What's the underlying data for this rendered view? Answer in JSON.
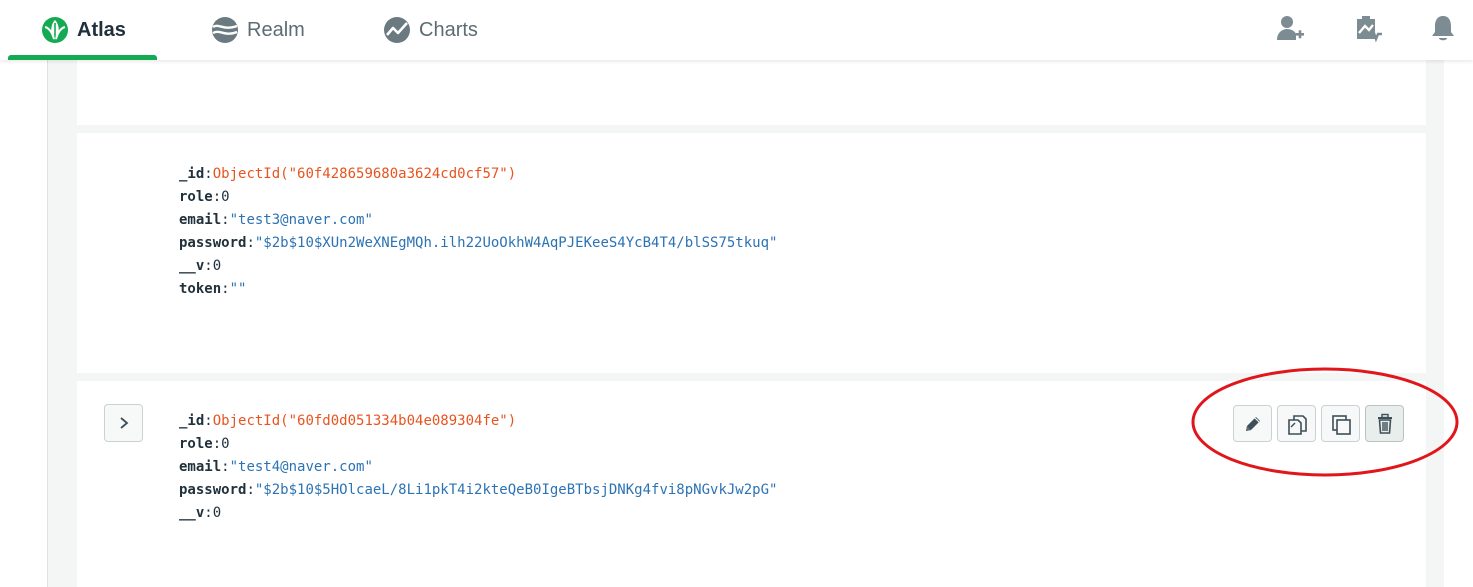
{
  "topnav": {
    "tabs": [
      {
        "label": "Atlas",
        "icon": "atlas-leaf-icon",
        "active": true
      },
      {
        "label": "Realm",
        "icon": "realm-icon",
        "active": false
      },
      {
        "label": "Charts",
        "icon": "charts-icon",
        "active": false
      }
    ],
    "right_icons": [
      "invite-user-icon",
      "activity-feed-icon",
      "bell-icon"
    ],
    "accent_color": "#13aa52"
  },
  "documents": [
    {
      "fields": []
    },
    {
      "fields": [
        {
          "key": "_id",
          "value": "ObjectId(\"60f428659680a3624cd0cf57\")",
          "type": "oid"
        },
        {
          "key": "role",
          "value": "0",
          "type": "num"
        },
        {
          "key": "email",
          "value": "\"test3@naver.com\"",
          "type": "str"
        },
        {
          "key": "password",
          "value": "\"$2b$10$XUn2WeXNEgMQh.ilh22UoOkhW4AqPJEKeeS4YcB4T4/blSS75tkuq\"",
          "type": "str"
        },
        {
          "key": "__v",
          "value": "0",
          "type": "num"
        },
        {
          "key": "token",
          "value": "\"\"",
          "type": "str"
        }
      ]
    },
    {
      "fields": [
        {
          "key": "_id",
          "value": "ObjectId(\"60fd0d051334b04e089304fe\")",
          "type": "oid"
        },
        {
          "key": "role",
          "value": "0",
          "type": "num"
        },
        {
          "key": "email",
          "value": "\"test4@naver.com\"",
          "type": "str"
        },
        {
          "key": "password",
          "value": "\"$2b$10$5HOlcaeL/8Li1pkT4i2kteQeB0IgeBTbsjDNKg4fvi8pNGvkJw2pG\"",
          "type": "str"
        },
        {
          "key": "__v",
          "value": "0",
          "type": "num"
        }
      ]
    }
  ],
  "separator": ":",
  "document_actions": [
    {
      "icon": "pencil-icon",
      "name": "edit-document-button"
    },
    {
      "icon": "copy-document-icon",
      "name": "copy-document-button"
    },
    {
      "icon": "clone-document-icon",
      "name": "clone-document-button"
    },
    {
      "icon": "trash-icon",
      "name": "delete-document-button"
    }
  ],
  "annotation_color": "#e0161b"
}
